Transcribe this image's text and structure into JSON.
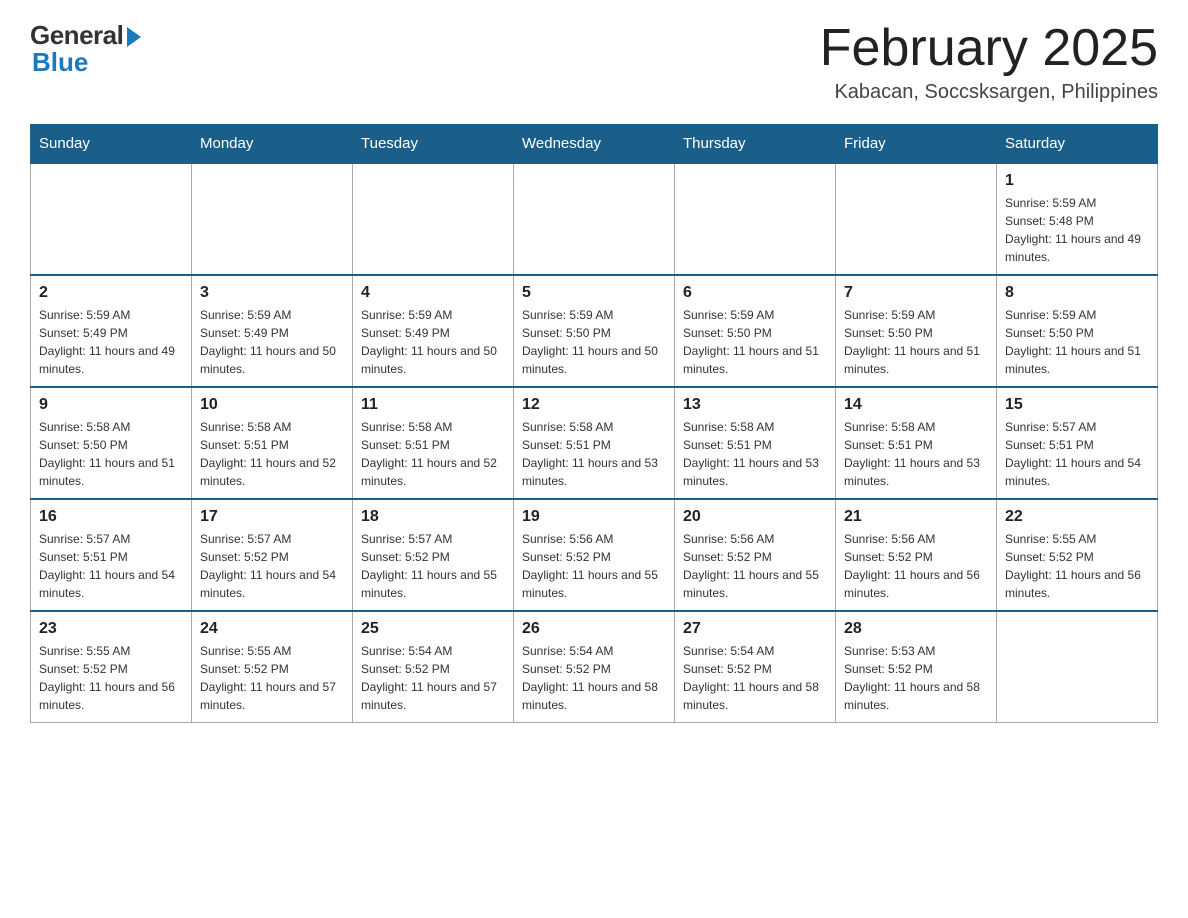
{
  "logo": {
    "general": "General",
    "blue": "Blue"
  },
  "header": {
    "month": "February 2025",
    "location": "Kabacan, Soccsksargen, Philippines"
  },
  "weekdays": [
    "Sunday",
    "Monday",
    "Tuesday",
    "Wednesday",
    "Thursday",
    "Friday",
    "Saturday"
  ],
  "weeks": [
    [
      {
        "day": "",
        "sunrise": "",
        "sunset": "",
        "daylight": ""
      },
      {
        "day": "",
        "sunrise": "",
        "sunset": "",
        "daylight": ""
      },
      {
        "day": "",
        "sunrise": "",
        "sunset": "",
        "daylight": ""
      },
      {
        "day": "",
        "sunrise": "",
        "sunset": "",
        "daylight": ""
      },
      {
        "day": "",
        "sunrise": "",
        "sunset": "",
        "daylight": ""
      },
      {
        "day": "",
        "sunrise": "",
        "sunset": "",
        "daylight": ""
      },
      {
        "day": "1",
        "sunrise": "Sunrise: 5:59 AM",
        "sunset": "Sunset: 5:48 PM",
        "daylight": "Daylight: 11 hours and 49 minutes."
      }
    ],
    [
      {
        "day": "2",
        "sunrise": "Sunrise: 5:59 AM",
        "sunset": "Sunset: 5:49 PM",
        "daylight": "Daylight: 11 hours and 49 minutes."
      },
      {
        "day": "3",
        "sunrise": "Sunrise: 5:59 AM",
        "sunset": "Sunset: 5:49 PM",
        "daylight": "Daylight: 11 hours and 50 minutes."
      },
      {
        "day": "4",
        "sunrise": "Sunrise: 5:59 AM",
        "sunset": "Sunset: 5:49 PM",
        "daylight": "Daylight: 11 hours and 50 minutes."
      },
      {
        "day": "5",
        "sunrise": "Sunrise: 5:59 AM",
        "sunset": "Sunset: 5:50 PM",
        "daylight": "Daylight: 11 hours and 50 minutes."
      },
      {
        "day": "6",
        "sunrise": "Sunrise: 5:59 AM",
        "sunset": "Sunset: 5:50 PM",
        "daylight": "Daylight: 11 hours and 51 minutes."
      },
      {
        "day": "7",
        "sunrise": "Sunrise: 5:59 AM",
        "sunset": "Sunset: 5:50 PM",
        "daylight": "Daylight: 11 hours and 51 minutes."
      },
      {
        "day": "8",
        "sunrise": "Sunrise: 5:59 AM",
        "sunset": "Sunset: 5:50 PM",
        "daylight": "Daylight: 11 hours and 51 minutes."
      }
    ],
    [
      {
        "day": "9",
        "sunrise": "Sunrise: 5:58 AM",
        "sunset": "Sunset: 5:50 PM",
        "daylight": "Daylight: 11 hours and 51 minutes."
      },
      {
        "day": "10",
        "sunrise": "Sunrise: 5:58 AM",
        "sunset": "Sunset: 5:51 PM",
        "daylight": "Daylight: 11 hours and 52 minutes."
      },
      {
        "day": "11",
        "sunrise": "Sunrise: 5:58 AM",
        "sunset": "Sunset: 5:51 PM",
        "daylight": "Daylight: 11 hours and 52 minutes."
      },
      {
        "day": "12",
        "sunrise": "Sunrise: 5:58 AM",
        "sunset": "Sunset: 5:51 PM",
        "daylight": "Daylight: 11 hours and 53 minutes."
      },
      {
        "day": "13",
        "sunrise": "Sunrise: 5:58 AM",
        "sunset": "Sunset: 5:51 PM",
        "daylight": "Daylight: 11 hours and 53 minutes."
      },
      {
        "day": "14",
        "sunrise": "Sunrise: 5:58 AM",
        "sunset": "Sunset: 5:51 PM",
        "daylight": "Daylight: 11 hours and 53 minutes."
      },
      {
        "day": "15",
        "sunrise": "Sunrise: 5:57 AM",
        "sunset": "Sunset: 5:51 PM",
        "daylight": "Daylight: 11 hours and 54 minutes."
      }
    ],
    [
      {
        "day": "16",
        "sunrise": "Sunrise: 5:57 AM",
        "sunset": "Sunset: 5:51 PM",
        "daylight": "Daylight: 11 hours and 54 minutes."
      },
      {
        "day": "17",
        "sunrise": "Sunrise: 5:57 AM",
        "sunset": "Sunset: 5:52 PM",
        "daylight": "Daylight: 11 hours and 54 minutes."
      },
      {
        "day": "18",
        "sunrise": "Sunrise: 5:57 AM",
        "sunset": "Sunset: 5:52 PM",
        "daylight": "Daylight: 11 hours and 55 minutes."
      },
      {
        "day": "19",
        "sunrise": "Sunrise: 5:56 AM",
        "sunset": "Sunset: 5:52 PM",
        "daylight": "Daylight: 11 hours and 55 minutes."
      },
      {
        "day": "20",
        "sunrise": "Sunrise: 5:56 AM",
        "sunset": "Sunset: 5:52 PM",
        "daylight": "Daylight: 11 hours and 55 minutes."
      },
      {
        "day": "21",
        "sunrise": "Sunrise: 5:56 AM",
        "sunset": "Sunset: 5:52 PM",
        "daylight": "Daylight: 11 hours and 56 minutes."
      },
      {
        "day": "22",
        "sunrise": "Sunrise: 5:55 AM",
        "sunset": "Sunset: 5:52 PM",
        "daylight": "Daylight: 11 hours and 56 minutes."
      }
    ],
    [
      {
        "day": "23",
        "sunrise": "Sunrise: 5:55 AM",
        "sunset": "Sunset: 5:52 PM",
        "daylight": "Daylight: 11 hours and 56 minutes."
      },
      {
        "day": "24",
        "sunrise": "Sunrise: 5:55 AM",
        "sunset": "Sunset: 5:52 PM",
        "daylight": "Daylight: 11 hours and 57 minutes."
      },
      {
        "day": "25",
        "sunrise": "Sunrise: 5:54 AM",
        "sunset": "Sunset: 5:52 PM",
        "daylight": "Daylight: 11 hours and 57 minutes."
      },
      {
        "day": "26",
        "sunrise": "Sunrise: 5:54 AM",
        "sunset": "Sunset: 5:52 PM",
        "daylight": "Daylight: 11 hours and 58 minutes."
      },
      {
        "day": "27",
        "sunrise": "Sunrise: 5:54 AM",
        "sunset": "Sunset: 5:52 PM",
        "daylight": "Daylight: 11 hours and 58 minutes."
      },
      {
        "day": "28",
        "sunrise": "Sunrise: 5:53 AM",
        "sunset": "Sunset: 5:52 PM",
        "daylight": "Daylight: 11 hours and 58 minutes."
      },
      {
        "day": "",
        "sunrise": "",
        "sunset": "",
        "daylight": ""
      }
    ]
  ]
}
